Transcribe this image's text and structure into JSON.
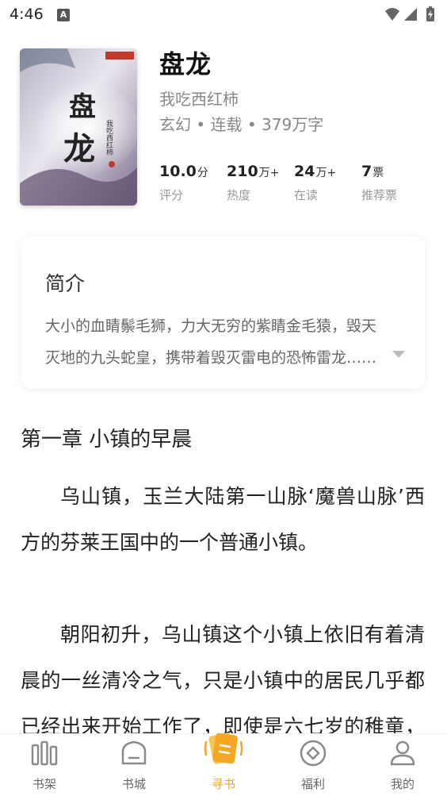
{
  "status_bar": {
    "time": "4:46",
    "notification_badge": "A"
  },
  "book": {
    "title": "盘龙",
    "author": "我吃西红柿",
    "meta": "玄幻 • 连载 • 379万字",
    "cover": {
      "title": "盘龙",
      "author": "我吃西红柿",
      "tint": "#8a7fa0"
    },
    "stats": [
      {
        "value": "10.0",
        "unit": "分",
        "label": "评分"
      },
      {
        "value": "210",
        "unit": "万+",
        "label": "热度"
      },
      {
        "value": "24",
        "unit": "万+",
        "label": "在读"
      },
      {
        "value": "7",
        "unit": "票",
        "label": "推荐票"
      }
    ]
  },
  "intro": {
    "heading": "简介",
    "text": "大小的血睛鬃毛狮，力大无穷的紫睛金毛猿，毁天灭地的九头蛇皇，携带着毁灭雷电的恐怖雷龙……"
  },
  "chapter": {
    "title": "第一章 小镇的早晨",
    "paragraph_1": "乌山镇，玉兰大陆第一山脉‘魔兽山脉’西方的芬莱王国中的一个普通小镇。",
    "paragraph_2": "朝阳初升，乌山镇这个小镇上依旧有着清晨的一丝清冷之气，只是小镇中的居民几乎都已经出来开始工作了，即使是六七岁的稚童，也差不多也都起床开始了传"
  },
  "nav": {
    "items": [
      {
        "label": "书架",
        "icon": "bookshelf-icon"
      },
      {
        "label": "书城",
        "icon": "bookstore-icon"
      },
      {
        "label": "寻书",
        "icon": "find-book-icon"
      },
      {
        "label": "福利",
        "icon": "welfare-icon"
      },
      {
        "label": "我的",
        "icon": "profile-icon"
      }
    ],
    "active_color": "#f5a623",
    "inactive_color": "#888888"
  }
}
